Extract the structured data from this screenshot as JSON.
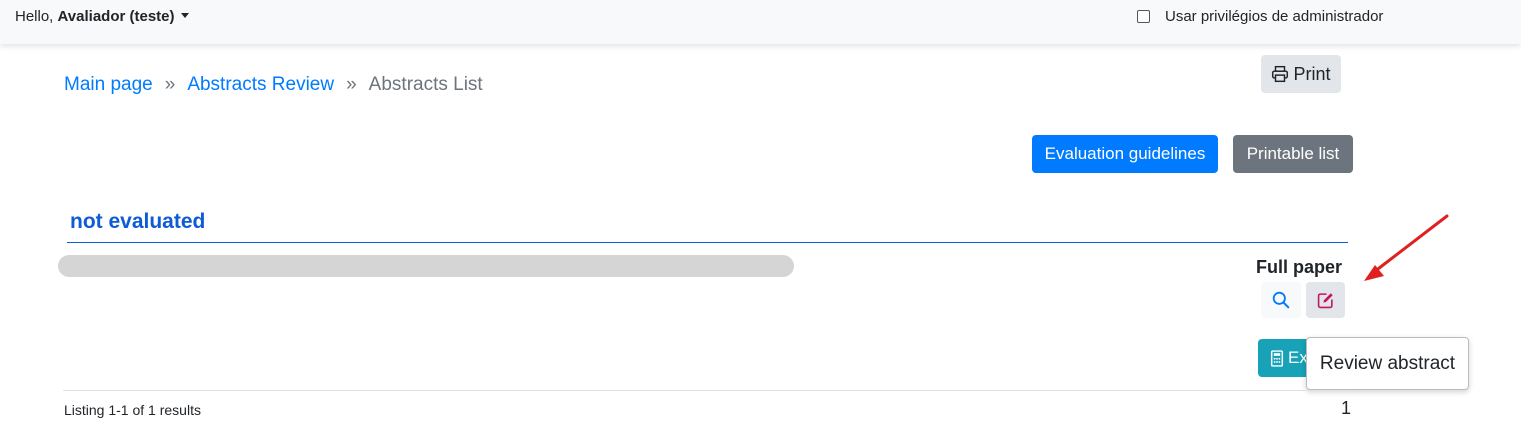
{
  "topbar": {
    "greeting_prefix": "Hello, ",
    "user_name": "Avaliador (teste)",
    "admin_label": "Usar privilégios de administrador",
    "admin_checked": false
  },
  "breadcrumb": {
    "items": [
      "Main page",
      "Abstracts Review",
      "Abstracts List"
    ],
    "separator": "»"
  },
  "toolbar": {
    "print_label": "Print",
    "guidelines_label": "Evaluation guidelines",
    "printable_label": "Printable list"
  },
  "section": {
    "title": "not evaluated"
  },
  "abstract": {
    "type_label": "Full paper",
    "export_label": "Ex",
    "view_icon": "search-icon",
    "review_icon": "edit-icon"
  },
  "tooltip": {
    "text": "Review abstract"
  },
  "footer": {
    "listing": "Listing 1-1 of 1 results",
    "page": "1"
  },
  "colors": {
    "primary": "#007bff",
    "secondary": "#6c757d",
    "info": "#17a2b8",
    "section_title": "#0d5bd6",
    "annotation_arrow": "#e02020"
  }
}
